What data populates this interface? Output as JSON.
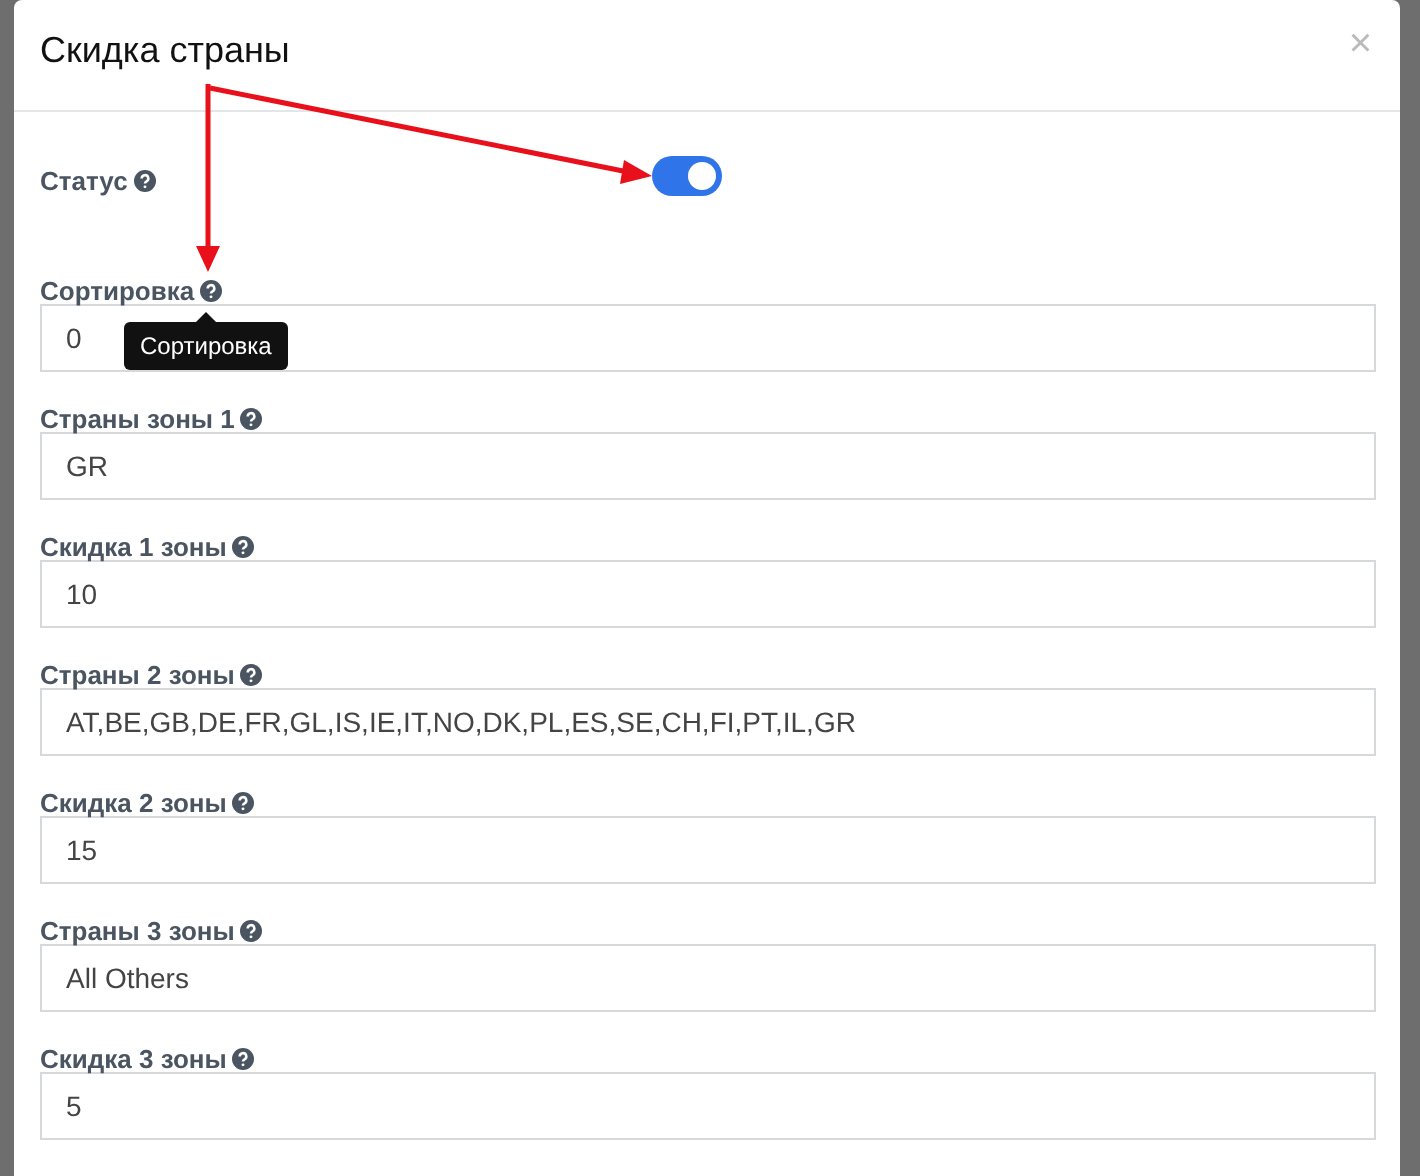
{
  "modal": {
    "title": "Скидка страны",
    "close": "×"
  },
  "status": {
    "label": "Статус",
    "on": true
  },
  "fields": [
    {
      "label": "Сортировка",
      "value": "0",
      "tooltip": "Сортировка"
    },
    {
      "label": "Страны зоны 1",
      "value": "GR"
    },
    {
      "label": "Скидка 1 зоны",
      "value": "10"
    },
    {
      "label": "Страны 2 зоны",
      "value": "AT,BE,GB,DE,FR,GL,IS,IE,IT,NO,DK,PL,ES,SE,CH,FI,PT,IL,GR"
    },
    {
      "label": "Скидка 2 зоны",
      "value": "15"
    },
    {
      "label": "Страны 3 зоны",
      "value": "All Others"
    },
    {
      "label": "Скидка 3 зоны",
      "value": "5"
    }
  ]
}
